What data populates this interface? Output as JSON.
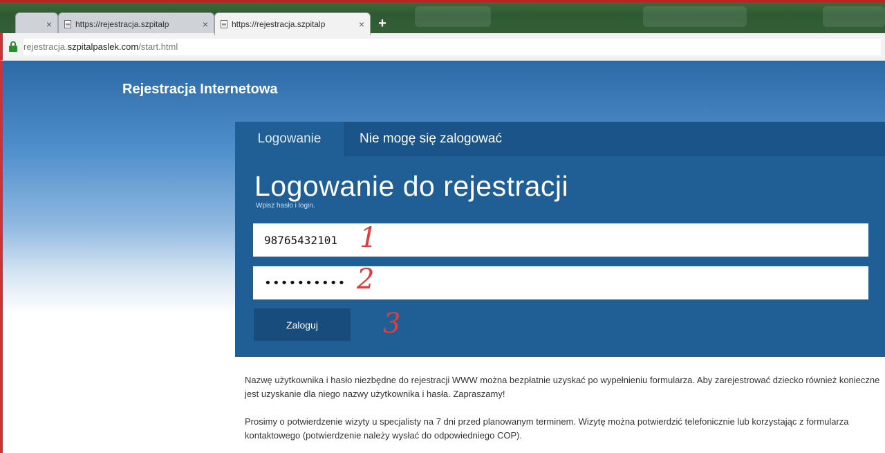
{
  "browser": {
    "tabs": [
      {
        "label": ""
      },
      {
        "label": "https://rejestracja.szpitalp"
      },
      {
        "label": "https://rejestracja.szpitalp"
      }
    ],
    "close_glyph": "×",
    "new_tab_glyph": "+",
    "url": {
      "prefix": "rejestracja.",
      "domain": "szpitalpaslek.com",
      "path": "/start.html"
    }
  },
  "site": {
    "title": "Rejestracja Internetowa"
  },
  "login_panel": {
    "tabs": {
      "login": "Logowanie",
      "cant_login": "Nie mogę się zalogować"
    },
    "heading": "Logowanie do rejestracji",
    "subheading": "Wpisz hasło i login.",
    "username_value": "98765432101",
    "password_value": "••••••••••",
    "submit_label": "Zaloguj"
  },
  "annotations": {
    "step1": "1",
    "step2": "2",
    "step3": "3"
  },
  "info": {
    "paragraph1": "Nazwę użytkownika i hasło niezbędne do rejestracji WWW można bezpłatnie uzyskać po wypełnieniu formularza. Aby zarejestrować dziecko również konieczne jest uzyskanie dla niego nazwy użytkownika i hasła. Zapraszamy!",
    "paragraph2": "Prosimy o potwierdzenie wizyty u specjalisty na 7 dni przed planowanym terminem. Wizytę można potwierdzić telefonicznie lub korzystając z formularza kontaktowego (potwierdzenie należy wysłać do odpowiedniego COP)."
  },
  "colors": {
    "panel": "#1f5f96",
    "panel_tabs": "#1a5488",
    "button": "#174c7c",
    "annotation": "#e23c3c"
  }
}
